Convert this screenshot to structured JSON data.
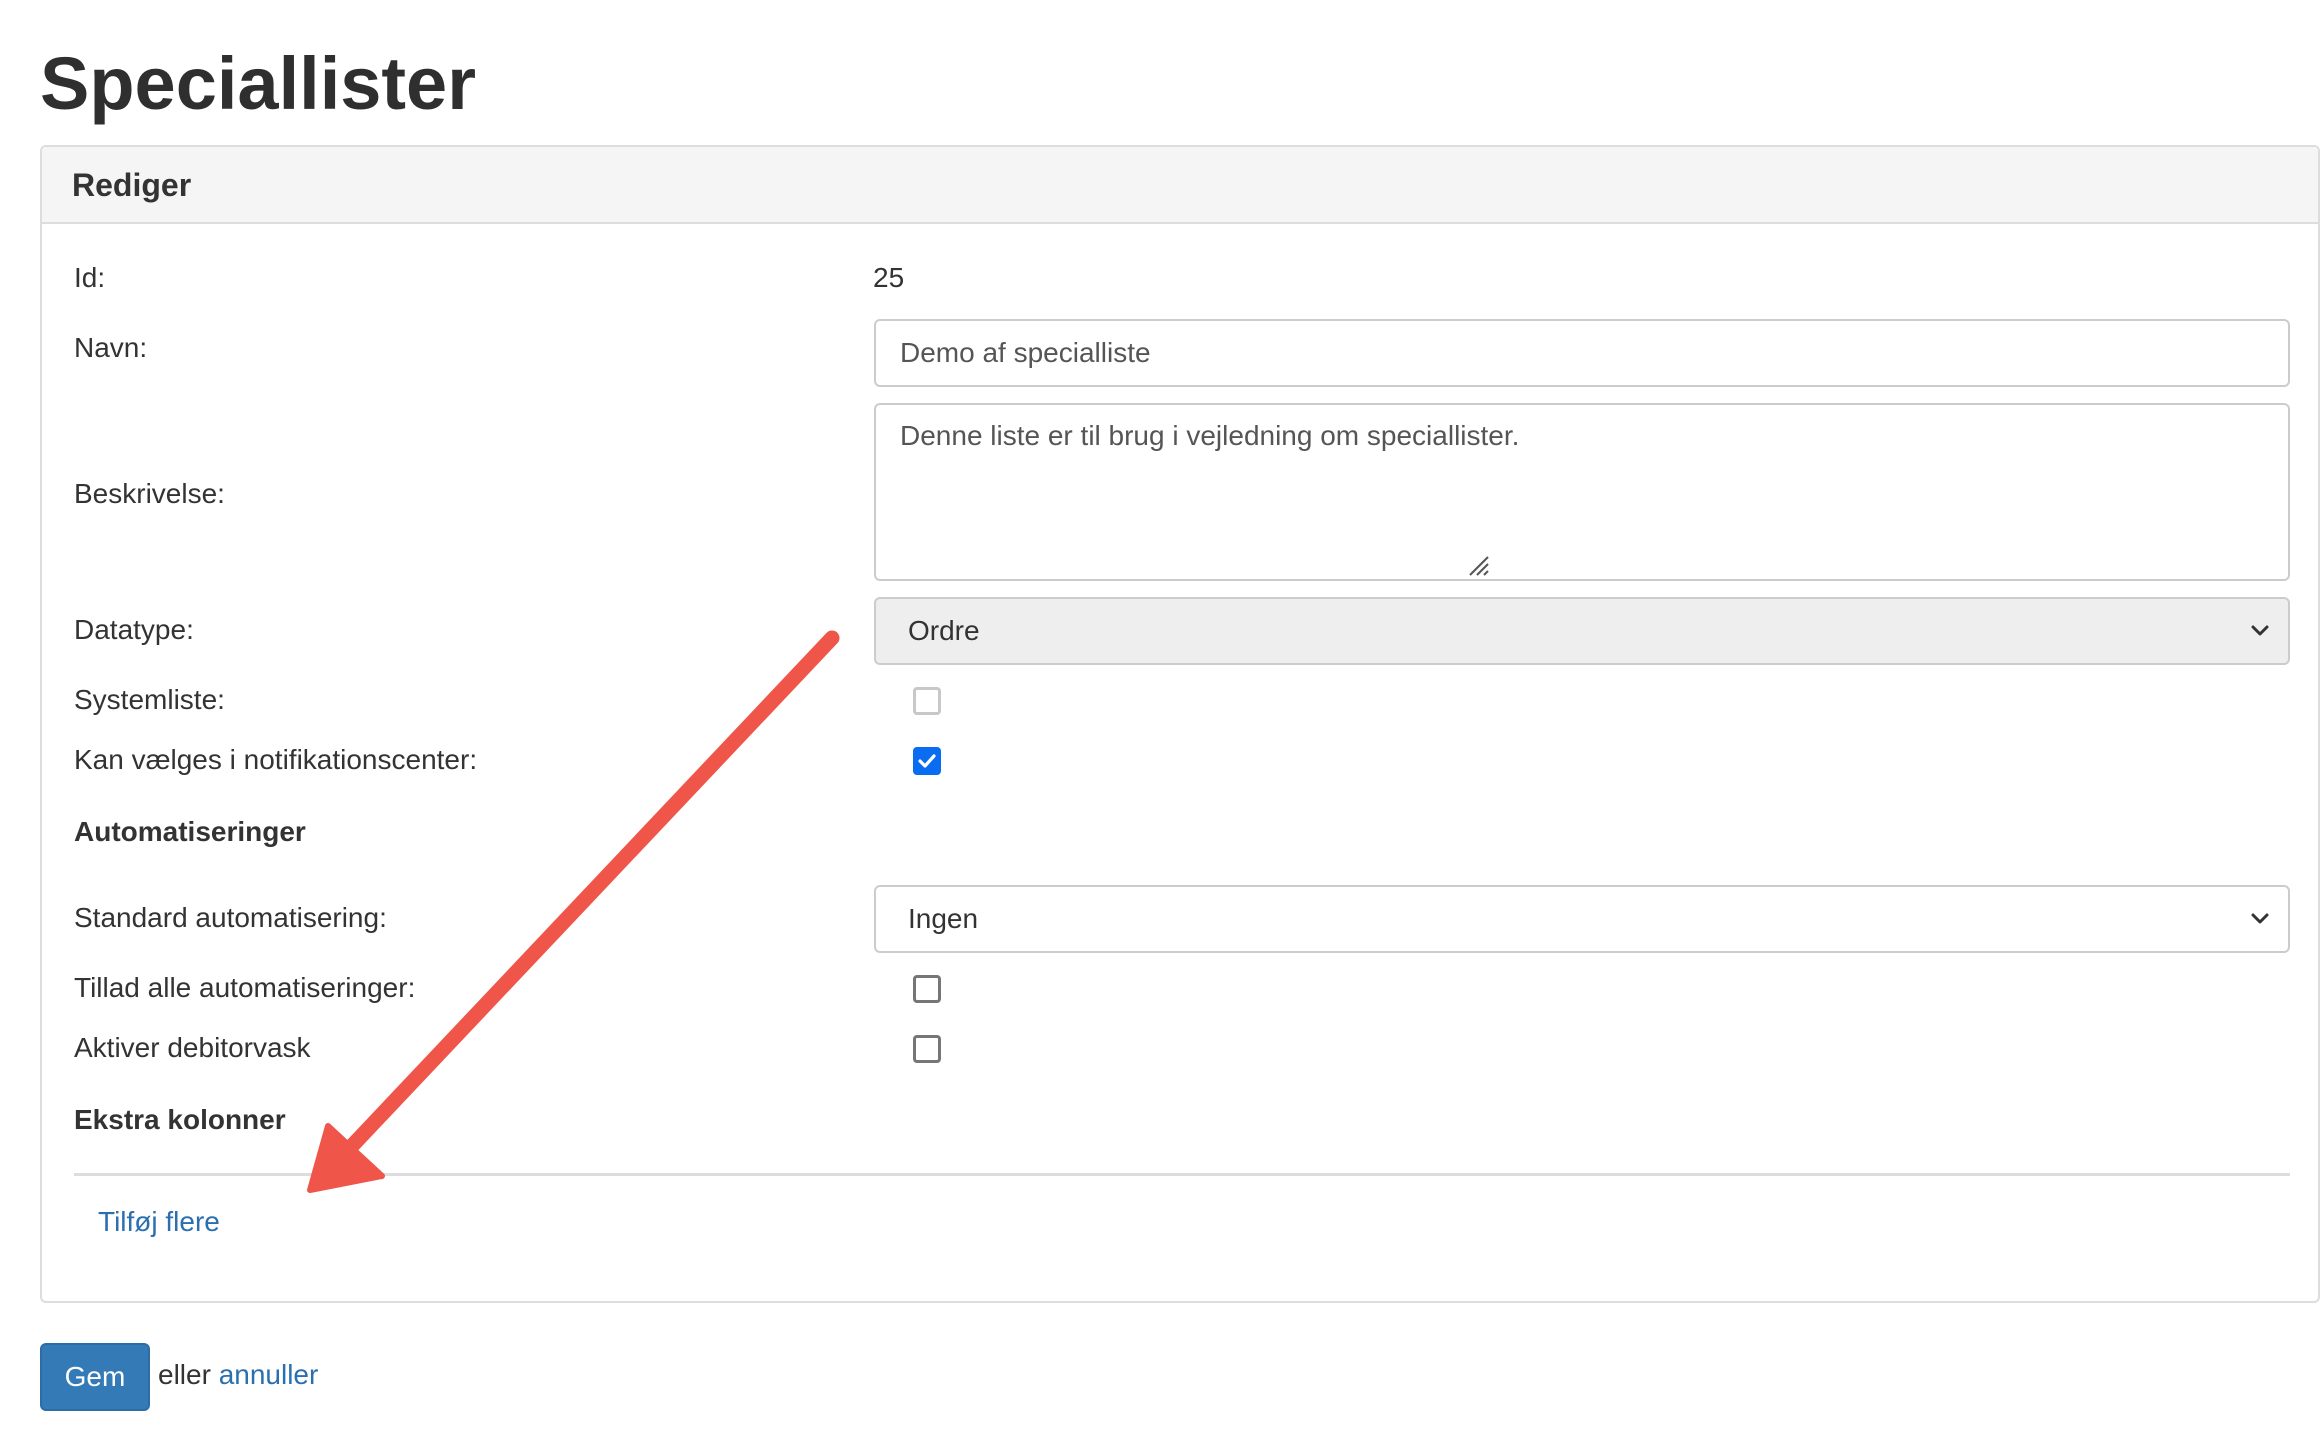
{
  "page": {
    "title": "Speciallister"
  },
  "panel": {
    "heading": "Rediger",
    "fields": {
      "id": {
        "label": "Id:",
        "value": "25"
      },
      "navn": {
        "label": "Navn:",
        "value": "Demo af specialliste"
      },
      "beskrivelse": {
        "label": "Beskrivelse:",
        "value": "Denne liste er til brug i vejledning om speciallister."
      },
      "datatype": {
        "label": "Datatype:",
        "selected": "Ordre",
        "disabled": true
      },
      "systemliste": {
        "label": "Systemliste:",
        "checked": false,
        "disabled": true
      },
      "notifikation": {
        "label": "Kan vælges i notifikationscenter:",
        "checked": true
      }
    },
    "automations": {
      "heading": "Automatiseringer",
      "standard": {
        "label": "Standard automatisering:",
        "selected": "Ingen"
      },
      "tillad": {
        "label": "Tillad alle automatiseringer:",
        "checked": false
      },
      "debitorvask": {
        "label": "Aktiver debitorvask",
        "checked": false
      }
    },
    "extra_columns": {
      "heading": "Ekstra kolonner",
      "add_link": "Tilføj flere"
    }
  },
  "footer": {
    "save_label": "Gem",
    "or_text": "eller",
    "cancel_link": "annuller"
  },
  "colors": {
    "primary_button": "#337ab7",
    "link": "#2a6fb0",
    "checkbox_checked": "#0a6cf0",
    "annotation_arrow": "#f0554a"
  }
}
